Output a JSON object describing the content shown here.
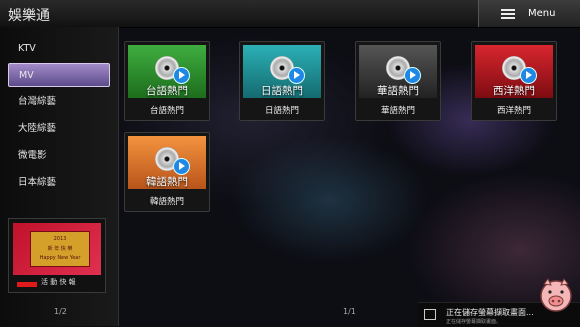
{
  "app": {
    "title": "娛樂通"
  },
  "menu": {
    "label": "Menu"
  },
  "sidebar": {
    "items": [
      {
        "label": "KTV",
        "active": false
      },
      {
        "label": "MV",
        "active": true
      },
      {
        "label": "台灣綜藝",
        "active": false
      },
      {
        "label": "大陸綜藝",
        "active": false
      },
      {
        "label": "微電影",
        "active": false
      },
      {
        "label": "日本綜藝",
        "active": false
      }
    ]
  },
  "promo": {
    "label": "活 動 快 報",
    "image_text": [
      "2013",
      "新 年 快 樂",
      "Happy New Year"
    ],
    "pager": "1/2"
  },
  "tiles": [
    {
      "title": "台語熱門",
      "caption": "台語熱門",
      "color": "#2e8b2e"
    },
    {
      "title": "日語熱門",
      "caption": "日語熱門",
      "color": "#1f8f95"
    },
    {
      "title": "華語熱門",
      "caption": "華語熱門",
      "color": "#3a3a3a"
    },
    {
      "title": "西洋熱門",
      "caption": "西洋熱門",
      "color": "#b2141c"
    },
    {
      "title": "韓語熱門",
      "caption": "韓語熱門",
      "color": "#e9772a"
    }
  ],
  "grid_pager": "1/1",
  "toast": {
    "title": "正在儲存螢幕擷取畫面...",
    "subtitle": "正在儲存螢幕擷取畫面。"
  }
}
